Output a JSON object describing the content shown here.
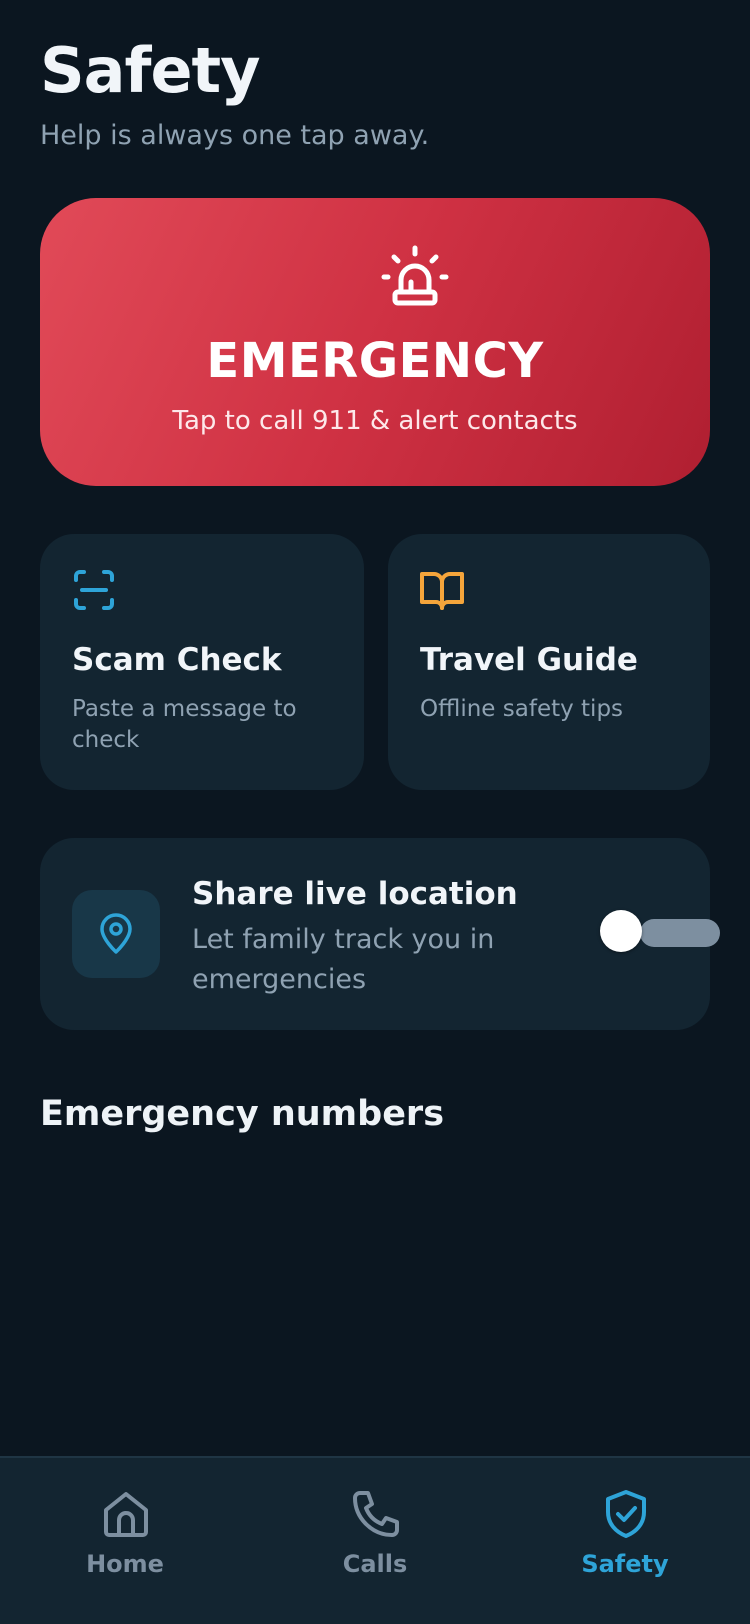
{
  "header": {
    "title": "Safety",
    "subtitle": "Help is always one tap away."
  },
  "emergency": {
    "icon": "siren-icon",
    "title": "EMERGENCY",
    "subtitle": "Tap to call 911 & alert contacts"
  },
  "cards": [
    {
      "icon": "scan-icon",
      "title": "Scam Check",
      "subtitle": "Paste a message to check"
    },
    {
      "icon": "book-open-icon",
      "title": "Travel Guide",
      "subtitle": "Offline safety tips"
    }
  ],
  "share_location": {
    "icon": "map-pin-icon",
    "title": "Share live location",
    "subtitle": "Let family track you in emergencies",
    "enabled": false
  },
  "sections": {
    "emergency_numbers": "Emergency numbers"
  },
  "tabbar": {
    "tabs": [
      {
        "label": "Home",
        "icon": "home-icon",
        "active": false
      },
      {
        "label": "Calls",
        "icon": "phone-icon",
        "active": false
      },
      {
        "label": "Safety",
        "icon": "shield-check-icon",
        "active": true
      }
    ]
  },
  "colors": {
    "background": "#0b1620",
    "card": "#132531",
    "emergency_start": "#e14a58",
    "emergency_end": "#b01f31",
    "accent_blue": "#2ea4d8",
    "accent_amber": "#f5a53b",
    "muted_text": "#8fa2b2"
  }
}
